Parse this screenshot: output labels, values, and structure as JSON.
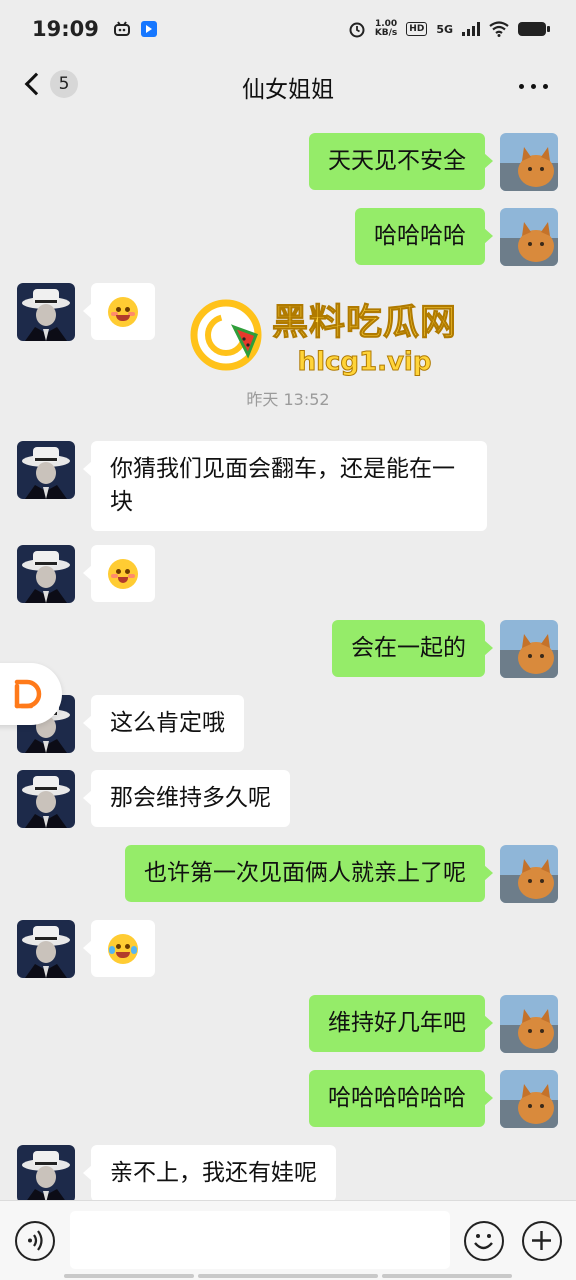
{
  "status_bar": {
    "time": "19:09",
    "net_speed_value": "1.00",
    "net_speed_unit": "KB/s",
    "hd_label": "HD",
    "network_label": "5G"
  },
  "header": {
    "title": "仙女姐姐",
    "unread_count": "5"
  },
  "timestamp": "昨天 13:52",
  "messages": [
    {
      "side": "right",
      "text": "天天见不安全"
    },
    {
      "side": "right",
      "text": "哈哈哈哈"
    },
    {
      "side": "left",
      "emoji": "grin-blush-emoji"
    },
    {
      "side": "left",
      "text": "你猜我们见面会翻车，还是能在一块"
    },
    {
      "side": "left",
      "emoji": "shy-emoji"
    },
    {
      "side": "right",
      "text": "会在一起的"
    },
    {
      "side": "left",
      "text": "这么肯定哦"
    },
    {
      "side": "left",
      "text": "那会维持多久呢"
    },
    {
      "side": "right",
      "text": "也许第一次见面俩人就亲上了呢"
    },
    {
      "side": "left",
      "emoji": "laugh-cry-emoji"
    },
    {
      "side": "right",
      "text": "维持好几年吧"
    },
    {
      "side": "right",
      "text": "哈哈哈哈哈哈"
    },
    {
      "side": "left",
      "text": "亲不上，我还有娃呢"
    }
  ],
  "watermark": {
    "title": "黑料吃瓜网",
    "url": "hlcg1.vip"
  },
  "colors": {
    "background": "#ededed",
    "outgoing_bubble": "#95ec69",
    "incoming_bubble": "#ffffff",
    "watermark_yellow": "#ffd43a",
    "didi_orange": "#ff7a1a"
  }
}
